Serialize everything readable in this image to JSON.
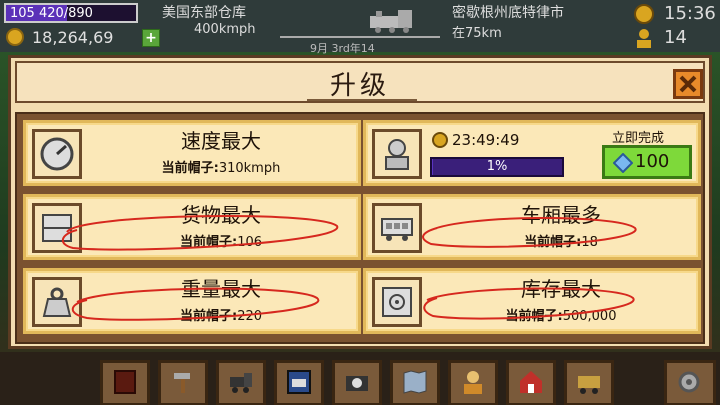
{
  "hud": {
    "xp_text": "105  420/890",
    "xp_fraction": 0.47,
    "money": "18,264,69",
    "depot": "美国东部仓库",
    "speed": "400kmph",
    "date": "9月 3rd年14",
    "destination": "密歇根州底特律市",
    "eta": "在75km",
    "time": "15:36",
    "workers": "14"
  },
  "modal": {
    "title": "升级",
    "cards": [
      {
        "title": "速度最大",
        "sub_label": "当前帽子:",
        "sub_value": "310kmph",
        "icon": "speedometer-icon"
      },
      {
        "title": "货物最大",
        "sub_label": "当前帽子:",
        "sub_value": "106",
        "icon": "cargo-icon"
      },
      {
        "title": "重量最大",
        "sub_label": "当前帽子:",
        "sub_value": "220",
        "icon": "weight-icon"
      },
      {
        "title": "车厢最多",
        "sub_label": "当前帽子:",
        "sub_value": "18",
        "icon": "wagon-icon"
      },
      {
        "title": "库存最大",
        "sub_label": "当前帽子:",
        "sub_value": "500,000",
        "icon": "safe-icon"
      }
    ],
    "upgrade_progress": {
      "timer": "23:49:49",
      "progress_text": "1%",
      "progress_fraction": 0.01,
      "finish_label": "立即完成",
      "gem_cost": "100"
    }
  },
  "bottom_bar": [
    "book-icon",
    "hammer-icon",
    "locomotive-icon",
    "train-card-icon",
    "camera-icon",
    "map-icon",
    "worker-icon",
    "station-icon",
    "wagon-icon",
    "settings-icon"
  ],
  "colors": {
    "accent_purple": "#5a34c2",
    "gem_button": "#7ed93a",
    "close_button": "#e88a2a"
  }
}
